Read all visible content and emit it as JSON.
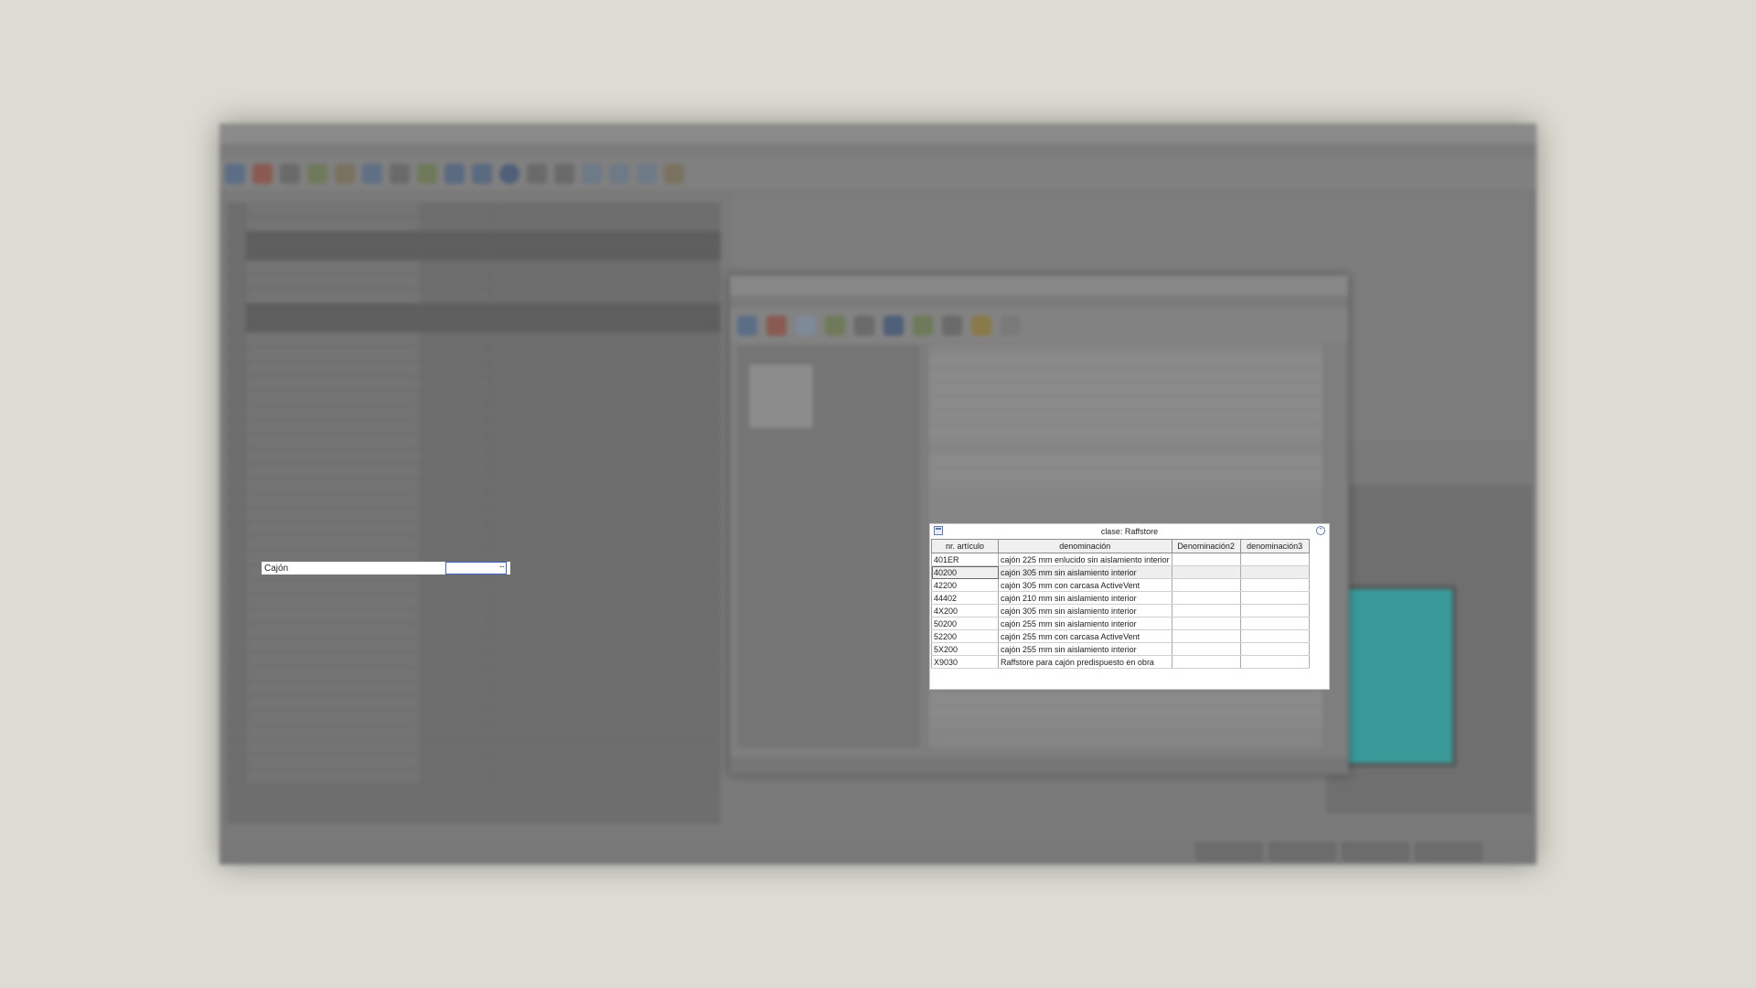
{
  "editor": {
    "row_label": "Cajón",
    "row_value_dots": "..."
  },
  "lookup_panel": {
    "title": "clase: Raffstore",
    "columns": [
      "nr. artículo",
      "denominación",
      "Denominación2",
      "denominación3"
    ],
    "rows": [
      {
        "nr": "401ER",
        "den": "cajón 225 mm enlucido sin aislamiento interior",
        "den2": "",
        "den3": ""
      },
      {
        "nr": "40200",
        "den": "cajón 305 mm sin aislamiento interior",
        "den2": "",
        "den3": ""
      },
      {
        "nr": "42200",
        "den": "cajón 305 mm con carcasa ActiveVent",
        "den2": "",
        "den3": ""
      },
      {
        "nr": "44402",
        "den": "cajón 210 mm sin aislamiento interior",
        "den2": "",
        "den3": ""
      },
      {
        "nr": "4X200",
        "den": "cajón 305 mm sin aislamiento interior",
        "den2": "",
        "den3": ""
      },
      {
        "nr": "50200",
        "den": "cajón 255 mm sin aislamiento interior",
        "den2": "",
        "den3": ""
      },
      {
        "nr": "52200",
        "den": "cajón 255 mm con carcasa ActiveVent",
        "den2": "",
        "den3": ""
      },
      {
        "nr": "5X200",
        "den": "cajón 255 mm sin aislamiento interior",
        "den2": "",
        "den3": ""
      },
      {
        "nr": "X9030",
        "den": "Raffstore para cajón predispuesto en obra",
        "den2": "",
        "den3": ""
      }
    ],
    "selected_row": 1
  },
  "colors": {
    "background": "#dcdcd3",
    "focus_border": "#3d63c7",
    "drawing_accent": "#3a9a9a"
  }
}
